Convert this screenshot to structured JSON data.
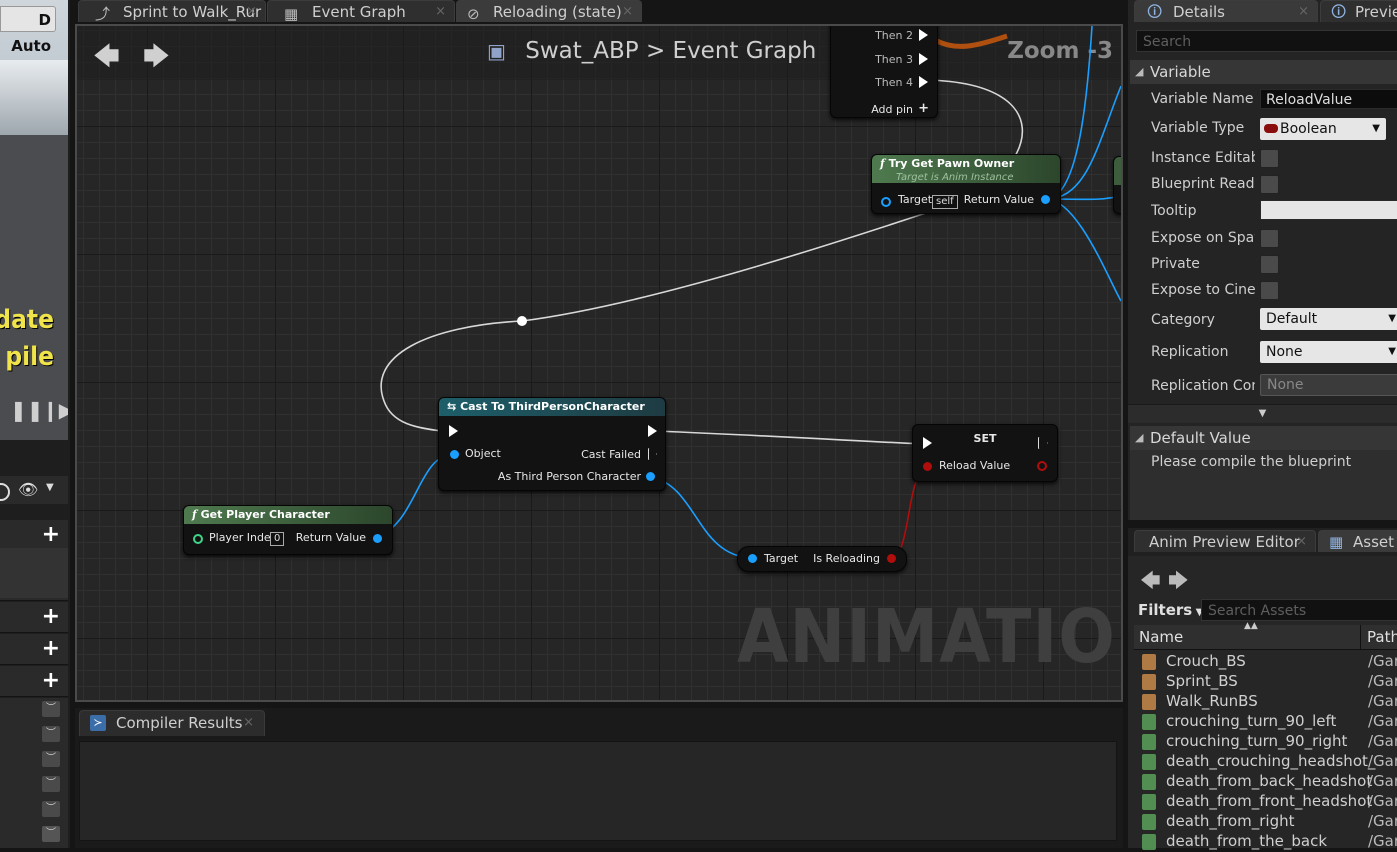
{
  "left_panel": {
    "mode_button": "D Auto",
    "overlay_line1": "date",
    "overlay_line2": "pile",
    "pause_icon": "pause-icon",
    "step_icon": "step-forward-icon"
  },
  "tabs": [
    {
      "label": "Sprint to Walk_Rur",
      "icon": "transition-icon"
    },
    {
      "label": "Event Graph",
      "icon": "graph-icon"
    },
    {
      "label": "Reloading (state)",
      "icon": "state-icon"
    }
  ],
  "graph": {
    "breadcrumb_root": "Swat_ABP",
    "breadcrumb_separator": ">",
    "breadcrumb_current": "Event Graph",
    "zoom": "Zoom -3",
    "watermark": "ANIMATION",
    "sequence_node": {
      "pins": [
        "Then 2",
        "Then 3",
        "Then 4"
      ],
      "add_pin": "Add pin"
    },
    "try_get_pawn": {
      "title": "Try Get Pawn Owner",
      "subtitle": "Target is Anim Instance",
      "target_label": "Target",
      "target_default": "self",
      "return_label": "Return Value"
    },
    "cast_node": {
      "title": "Cast To ThirdPersonCharacter",
      "object_label": "Object",
      "cast_failed_label": "Cast Failed",
      "as_label": "As Third Person Character"
    },
    "get_player": {
      "title": "Get Player Character",
      "index_label": "Player Index",
      "index_value": "0",
      "return_label": "Return Value"
    },
    "set_node": {
      "title": "SET",
      "value_label": "Reload Value"
    },
    "is_reloading": {
      "target_label": "Target",
      "output_label": "Is Reloading"
    },
    "colors": {
      "exec": "#ffffff",
      "object": "#1a9fff",
      "bool": "#b00d0d"
    }
  },
  "compiler": {
    "tab_label": "Compiler Results"
  },
  "details": {
    "tab_label": "Details",
    "preview_tab_label": "Previe",
    "search_placeholder": "Search",
    "section_variable": "Variable",
    "props": {
      "variable_name_label": "Variable Name",
      "variable_name_value": "ReloadValue",
      "variable_type_label": "Variable Type",
      "variable_type_value": "Boolean",
      "instance_editable_label": "Instance Editab",
      "blueprint_readonly_label": "Blueprint Read O",
      "tooltip_label": "Tooltip",
      "tooltip_value": "",
      "expose_spawn_label": "Expose on Spaw",
      "private_label": "Private",
      "expose_cinematics_label": "Expose to Ciner",
      "category_label": "Category",
      "category_value": "Default",
      "replication_label": "Replication",
      "replication_value": "None",
      "replication_condition_label": "Replication Con",
      "replication_condition_value": "None"
    },
    "section_default": "Default Value",
    "default_message": "Please compile the blueprint"
  },
  "assets": {
    "tab_anim_preview": "Anim Preview Editor",
    "tab_asset": "Asset",
    "filters_label": "Filters",
    "search_placeholder": "Search Assets",
    "col_name": "Name",
    "col_path": "Path",
    "rows": [
      {
        "name": "Crouch_BS",
        "path": "/Gar",
        "kind": "blendspace"
      },
      {
        "name": "Sprint_BS",
        "path": "/Gar",
        "kind": "blendspace"
      },
      {
        "name": "Walk_RunBS",
        "path": "/Gar",
        "kind": "blendspace"
      },
      {
        "name": "crouching_turn_90_left",
        "path": "/Gar",
        "kind": "anim"
      },
      {
        "name": "crouching_turn_90_right",
        "path": "/Gar",
        "kind": "anim"
      },
      {
        "name": "death_crouching_headshot_",
        "path": "/Gar",
        "kind": "anim"
      },
      {
        "name": "death_from_back_headshot",
        "path": "/Gar",
        "kind": "anim"
      },
      {
        "name": "death_from_front_headshot",
        "path": "/Gar",
        "kind": "anim"
      },
      {
        "name": "death_from_right",
        "path": "/Gar",
        "kind": "anim"
      },
      {
        "name": "death_from_the_back",
        "path": "/Gar",
        "kind": "anim"
      }
    ]
  }
}
